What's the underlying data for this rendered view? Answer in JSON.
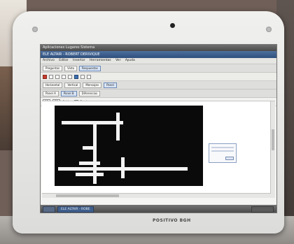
{
  "brand": "POSITIVO BGH",
  "desktop": {
    "topbar": "Aplicaciones  Lugares  Sistema",
    "window_title": "ELE ALTAIR - ROBERT DERIVIQUE",
    "menus": [
      "Archivo",
      "Editar",
      "Insertar",
      "Herramientas",
      "Ver",
      "Ayuda"
    ],
    "tabs": [
      "Preguntas",
      "Vista",
      "Respuestas"
    ],
    "subtabs": [
      "Horizontal",
      "Vertical",
      "Mensajes",
      "Panel"
    ],
    "subtabs2": [
      "Panel A",
      "Panel B",
      "Diferencias"
    ],
    "controls": {
      "size_value": "15",
      "zoom_value": "21",
      "label": "Celdas",
      "checkbox": "Borde"
    },
    "task_title": "ELE ALTAIR - ROBE"
  }
}
